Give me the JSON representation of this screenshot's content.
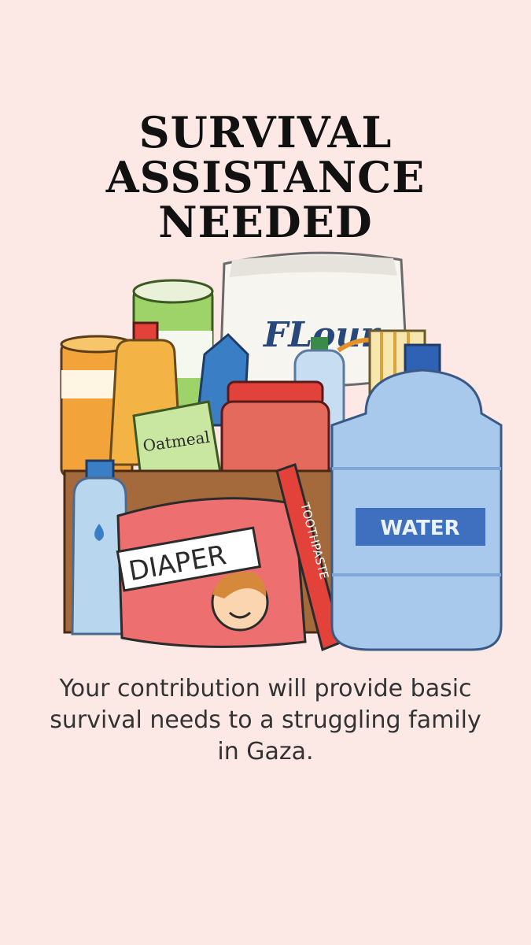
{
  "title_lines": [
    "SURVIVAL",
    "ASSISTANCE",
    "NEEDED"
  ],
  "illustration": {
    "flour_label": "FLour",
    "oatmeal_label": "Oatmeal",
    "diaper_label": "DIAPER",
    "toothpaste_label": "TOOTHPASTE",
    "water_label": "WATER"
  },
  "body_text": "Your contribution will provide basic survival needs to a struggling family in Gaza.",
  "colors": {
    "background": "#fce9e6",
    "title": "#111111",
    "body_text": "#333333",
    "water_jug": "#a9c9ec",
    "water_label": "#3f6fbf",
    "diaper_pack": "#ee6f6f",
    "box": "#a56a3c"
  }
}
